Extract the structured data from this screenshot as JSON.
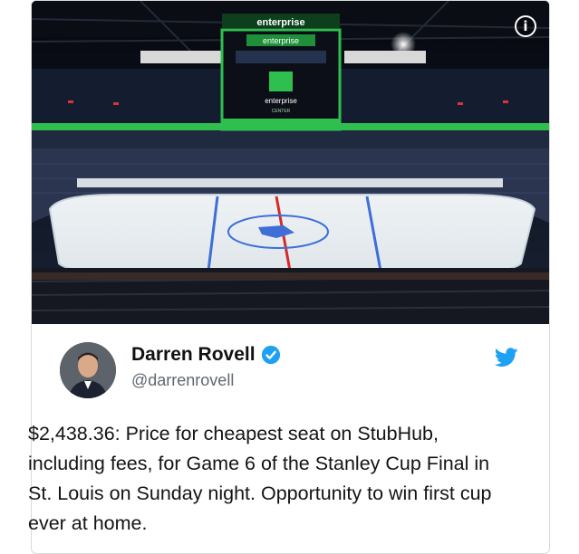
{
  "media": {
    "description_icon": "info-icon",
    "scoreboard_top_text": "enterprise",
    "scoreboard_panel_text": "enterprise",
    "scoreboard_center_text": "enterprise",
    "scoreboard_sub_text": "CENTER"
  },
  "tweet": {
    "author_name": "Darren Rovell",
    "handle": "@darrenrovell",
    "verified": true,
    "text": "$2,438.36: Price for cheapest seat on StubHub, including fees, for Game 6 of the Stanley Cup Final in St. Louis on Sunday night. Opportunity to win first cup ever at home.",
    "brand_icon": "twitter-bird-icon",
    "brand_color": "#1da1f2"
  }
}
